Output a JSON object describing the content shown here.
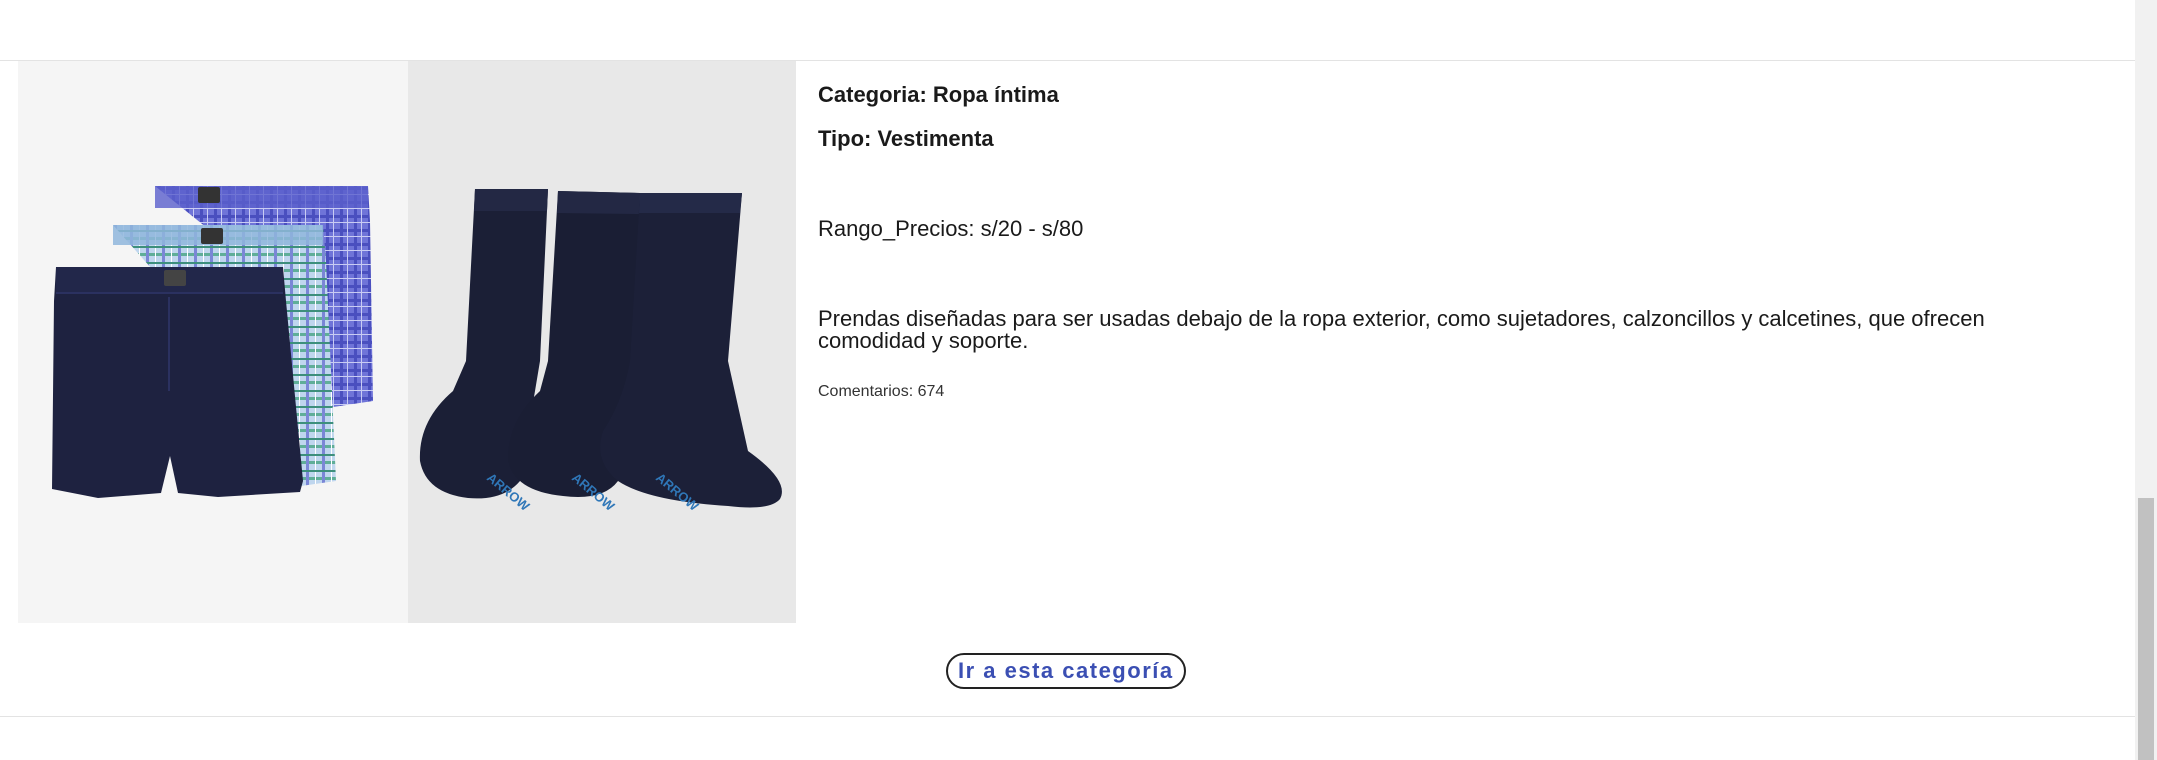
{
  "category_card": {
    "category_line": "Categoria: Ropa íntima",
    "type_line": "Tipo: Vestimenta",
    "price_range": "Rango_Precios: s/20 - s/80",
    "description": "Prendas diseñadas para ser usadas debajo de la ropa exterior, como sujetadores, calzoncillos y calcetines, que ofrecen comodidad y soporte.",
    "comments": "Comentarios: 674",
    "images": [
      {
        "name": "boxers-image"
      },
      {
        "name": "socks-image",
        "brand_text": "ARROW"
      }
    ],
    "cta_label": "Ir a esta categoría"
  },
  "colors": {
    "accent": "#3b4fb3",
    "navy": "#1e2240",
    "sock_brand": "#2f77b8"
  }
}
